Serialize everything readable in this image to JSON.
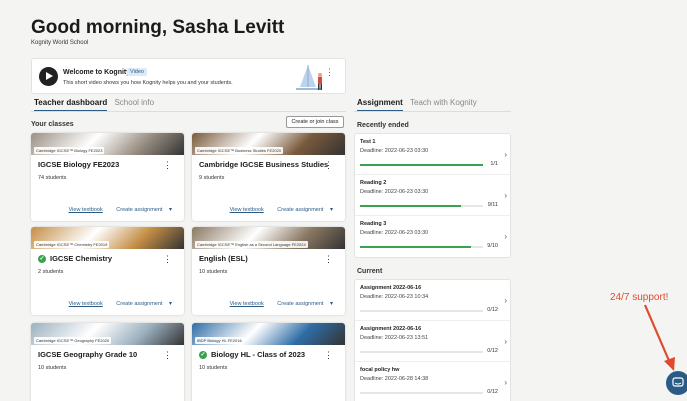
{
  "header": {
    "greeting": "Good morning, Sasha Levitt",
    "school": "Kognity World School"
  },
  "welcome": {
    "title": "Welcome to Kognity!",
    "badge": "Video",
    "subtitle": "This short video shows you how Kognity helps you and your students."
  },
  "left_tabs": [
    "Teacher dashboard",
    "School info"
  ],
  "create_button": "Create or join class",
  "your_classes_label": "Your classes",
  "cards": [
    {
      "tag": "Cambridge IGCSE™ Biology FE2023",
      "title": "IGCSE Biology FE2023",
      "students": "74 students",
      "verified": false,
      "view": "View textbook",
      "create": "Create assignment",
      "img_color": "#9a9083"
    },
    {
      "tag": "Cambridge IGCSE™ Business Studies FE2020",
      "title": "Cambridge IGCSE Business Studies",
      "students": "9 students",
      "verified": false,
      "view": "View textbook",
      "create": "Create assignment",
      "img_color": "#7a5a3c"
    },
    {
      "tag": "Cambridge IGCSE™ Chemistry FE2019",
      "title": "IGCSE Chemistry",
      "students": "2 students",
      "verified": true,
      "view": "View textbook",
      "create": "Create assignment",
      "img_color": "#c48e45"
    },
    {
      "tag": "Cambridge IGCSE™ English as a Second Language FE2024",
      "title": "English (ESL)",
      "students": "10 students",
      "verified": false,
      "view": "View textbook",
      "create": "Create assignment",
      "img_color": "#8a7862"
    },
    {
      "tag": "Cambridge IGCSE™ Geography FE2020",
      "title": "IGCSE Geography Grade 10",
      "students": "10 students",
      "verified": false,
      "view": "",
      "create": "",
      "img_color": "#9cb0bf"
    },
    {
      "tag": "IBDP Biology HL FE2016",
      "title": "Biology HL - Class of 2023",
      "students": "10 students",
      "verified": true,
      "view": "",
      "create": "",
      "img_color": "#2f6da6"
    }
  ],
  "right_tabs": [
    "Assignment",
    "Teach with Kognity"
  ],
  "recently_ended_label": "Recently ended",
  "recently_ended": [
    {
      "name": "Test 1",
      "deadline": "Deadline: 2022-06-23 03:30",
      "count": "1/1",
      "progress": 1.0
    },
    {
      "name": "Reading 2",
      "deadline": "Deadline: 2022-06-23 03:30",
      "count": "9/11",
      "progress": 0.818
    },
    {
      "name": "Reading 3",
      "deadline": "Deadline: 2022-06-23 03:30",
      "count": "9/10",
      "progress": 0.9
    }
  ],
  "current_label": "Current",
  "current": [
    {
      "name": "Assignment 2022-06-16",
      "deadline": "Deadline: 2022-06-23 10:34",
      "count": "0/12",
      "progress": 0
    },
    {
      "name": "Assignment 2022-06-16",
      "deadline": "Deadline: 2022-06-23 13:51",
      "count": "0/12",
      "progress": 0
    },
    {
      "name": "focal policy hw",
      "deadline": "Deadline: 2022-06-28 14:38",
      "count": "0/12",
      "progress": 0
    }
  ],
  "support_label": "24/7 support!",
  "colors": {
    "accent": "#2a5b86",
    "success": "#3aa14e",
    "annotation": "#e04a2e"
  }
}
